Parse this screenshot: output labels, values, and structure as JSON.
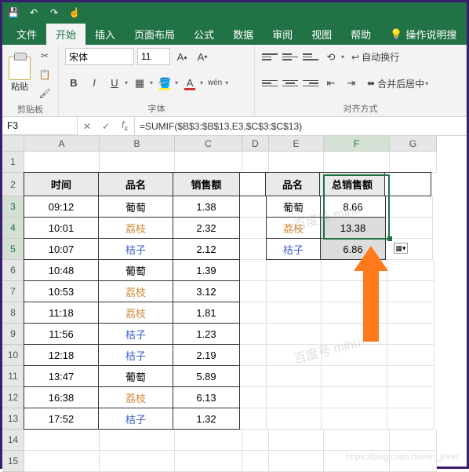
{
  "titlebar": {
    "icons": [
      "save-icon",
      "undo-icon",
      "redo-icon",
      "touch-icon"
    ]
  },
  "tabs": {
    "file": "文件",
    "home": "开始",
    "insert": "插入",
    "layout": "页面布局",
    "formulas": "公式",
    "data": "数据",
    "review": "审阅",
    "view": "视图",
    "help": "帮助",
    "tell": "操作说明搜"
  },
  "ribbon": {
    "clipboard_label": "剪贴板",
    "paste_label": "粘贴",
    "font_group_label": "字体",
    "font_name": "宋体",
    "font_size": "11",
    "align_group_label": "对齐方式",
    "wrap_text": "自动换行",
    "merge_center": "合并后居中"
  },
  "namebox": "F3",
  "formula": "=SUMIF($B$3:$B$13,E3,$C$3:$C$13)",
  "columns": [
    "A",
    "B",
    "C",
    "D",
    "E",
    "F",
    "G"
  ],
  "headers_left": {
    "time": "时间",
    "name": "品名",
    "sales": "销售额"
  },
  "headers_right": {
    "name": "品名",
    "total": "总销售额"
  },
  "rows_left": [
    {
      "t": "09:12",
      "n": "葡萄",
      "v": "1.38",
      "c": ""
    },
    {
      "t": "10:01",
      "n": "荔枝",
      "v": "2.32",
      "c": "pink"
    },
    {
      "t": "10:07",
      "n": "桔子",
      "v": "2.12",
      "c": "blue"
    },
    {
      "t": "10:48",
      "n": "葡萄",
      "v": "1.39",
      "c": ""
    },
    {
      "t": "10:53",
      "n": "荔枝",
      "v": "3.12",
      "c": "pink"
    },
    {
      "t": "11:18",
      "n": "荔枝",
      "v": "1.81",
      "c": "pink"
    },
    {
      "t": "11:56",
      "n": "桔子",
      "v": "1.23",
      "c": "blue"
    },
    {
      "t": "12:18",
      "n": "桔子",
      "v": "2.19",
      "c": "blue"
    },
    {
      "t": "13:47",
      "n": "葡萄",
      "v": "5.89",
      "c": ""
    },
    {
      "t": "16:38",
      "n": "荔枝",
      "v": "6.13",
      "c": "pink"
    },
    {
      "t": "17:52",
      "n": "桔子",
      "v": "1.32",
      "c": "blue"
    }
  ],
  "rows_right": [
    {
      "n": "葡萄",
      "v": "8.66",
      "c": ""
    },
    {
      "n": "荔枝",
      "v": "13.38",
      "c": "pink"
    },
    {
      "n": "桔子",
      "v": "6.86",
      "c": "blue"
    }
  ],
  "watermark": "百度号 mihu",
  "credit": "https://blog.csdn.net/en_joker"
}
